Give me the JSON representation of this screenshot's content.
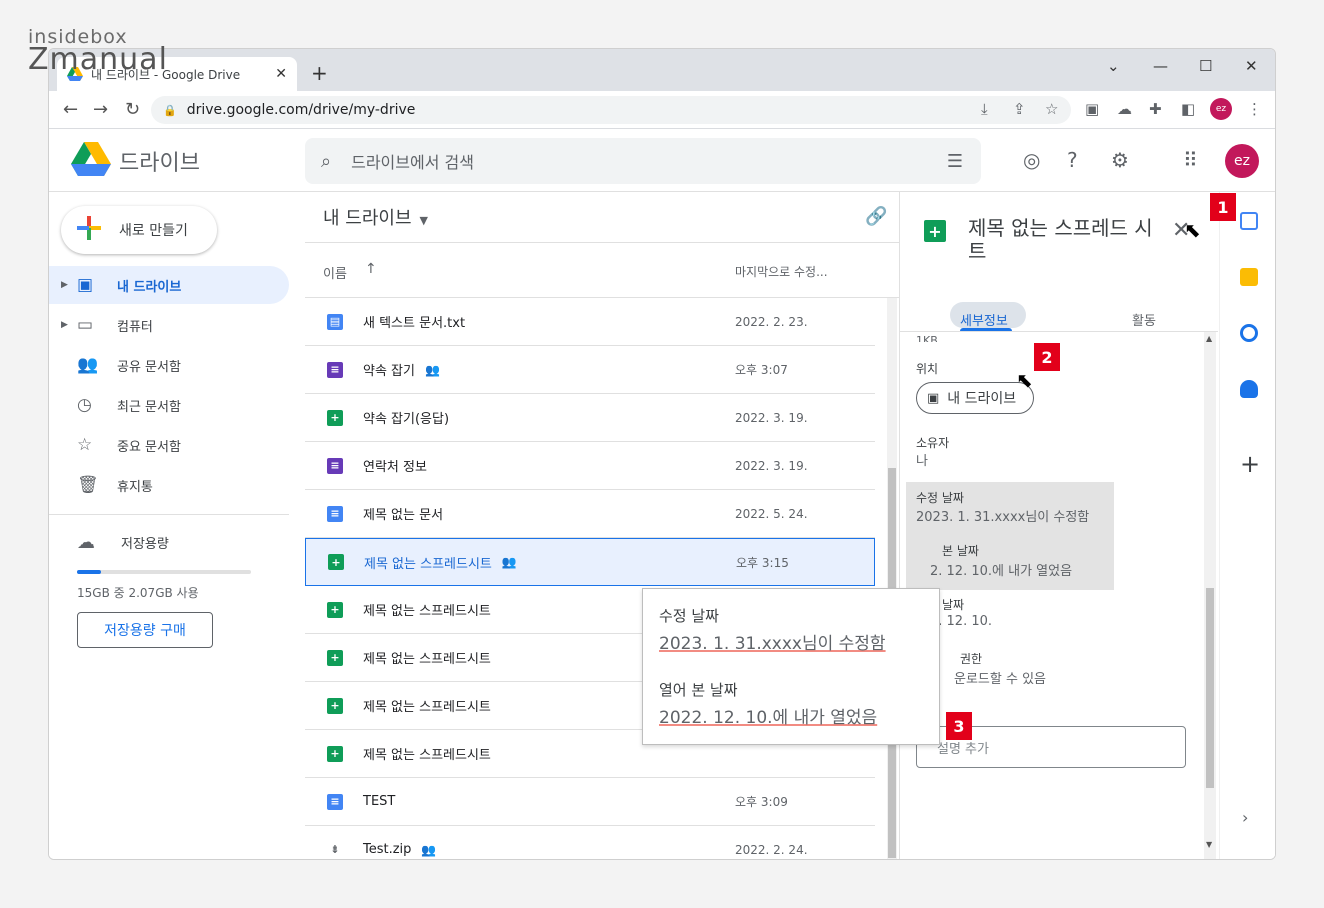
{
  "watermark": {
    "top": "insidebox",
    "bottom": "Zmanual"
  },
  "browser": {
    "tab_title": "내 드라이브 - Google Drive",
    "tab_close": "✕",
    "new_tab": "+",
    "url": "drive.google.com/drive/my-drive",
    "profile": "ez",
    "window_controls": [
      "⌄",
      "—",
      "☐",
      "✕"
    ]
  },
  "header": {
    "brand": "드라이브",
    "search_placeholder": "드라이브에서 검색",
    "avatar": "ez"
  },
  "sidebar": {
    "new_label": "새로 만들기",
    "items": [
      {
        "label": "내 드라이브",
        "icon": "my-drive-icon",
        "active": true,
        "caret": true
      },
      {
        "label": "컴퓨터",
        "icon": "computer-icon",
        "caret": true
      },
      {
        "label": "공유 문서함",
        "icon": "shared-icon"
      },
      {
        "label": "최근 문서함",
        "icon": "recent-icon"
      },
      {
        "label": "중요 문서함",
        "icon": "star-icon"
      },
      {
        "label": "휴지통",
        "icon": "trash-icon"
      }
    ],
    "storage_label": "저장용량",
    "storage_usage": "15GB 중 2.07GB 사용",
    "storage_fraction": 0.14,
    "buy_label": "저장용량 구매"
  },
  "main": {
    "breadcrumb": "내 드라이브",
    "col_name": "이름",
    "col_modified": "마지막으로 수정...",
    "files": [
      {
        "name": "새 텍스트 문서.txt",
        "type": "txt",
        "date": "2022. 2. 23.",
        "shared": false
      },
      {
        "name": "약속 잡기",
        "type": "form",
        "date": "오후 3:07",
        "shared": true
      },
      {
        "name": "약속 잡기(응답)",
        "type": "sheet",
        "date": "2022. 3. 19.",
        "shared": false
      },
      {
        "name": "연락처 정보",
        "type": "form",
        "date": "2022. 3. 19.",
        "shared": false
      },
      {
        "name": "제목 없는 문서",
        "type": "doc",
        "date": "2022. 5. 24.",
        "shared": false
      },
      {
        "name": "제목 없는 스프레드시트",
        "type": "sheet",
        "date": "오후 3:15",
        "shared": true,
        "selected": true
      },
      {
        "name": "제목 없는 스프레드시트",
        "type": "sheet",
        "date": "",
        "shared": false
      },
      {
        "name": "제목 없는 스프레드시트",
        "type": "sheet",
        "date": "",
        "shared": false
      },
      {
        "name": "제목 없는 스프레드시트",
        "type": "sheet",
        "date": "",
        "shared": false
      },
      {
        "name": "제목 없는 스프레드시트",
        "type": "sheet",
        "date": "",
        "shared": false
      },
      {
        "name": "TEST",
        "type": "doc",
        "date": "오후 3:09",
        "shared": false
      },
      {
        "name": "Test.zip",
        "type": "zip",
        "date": "2022. 2. 24.",
        "shared": true
      }
    ]
  },
  "details": {
    "title": "제목 없는 스프레드 시트",
    "tab_details": "세부정보",
    "tab_activity": "활동",
    "size_partial": "1KB",
    "location_label": "위치",
    "location_value": "내 드라이브",
    "owner_label": "소유자",
    "owner_value": "나",
    "modified_label": "수정 날짜",
    "modified_value": "2023. 1. 31.xxxx님이 수정함",
    "opened_label_partial": "본 날짜",
    "opened_value_partial": "2. 12. 10.에 내가 열었음",
    "created_label_partial": "날짜",
    "created_value_partial": "2. 12. 10.",
    "download_label_partial": "권한",
    "download_value_partial": "운로드할 수 있음",
    "desc_label": "설명",
    "desc_placeholder": "설명 추가"
  },
  "tooltip": {
    "modified_label": "수정 날짜",
    "modified_value": "2023. 1. 31.xxxx님이 수정함",
    "opened_label": "열어 본 날짜",
    "opened_value": "2022. 12. 10.에 내가 열었음"
  },
  "badges": [
    "1",
    "2",
    "3"
  ],
  "colors": {
    "accent": "#1a73e8",
    "badge": "#e2001a",
    "sheet": "#0f9d58",
    "doc": "#4285f4",
    "form": "#673ab7"
  }
}
